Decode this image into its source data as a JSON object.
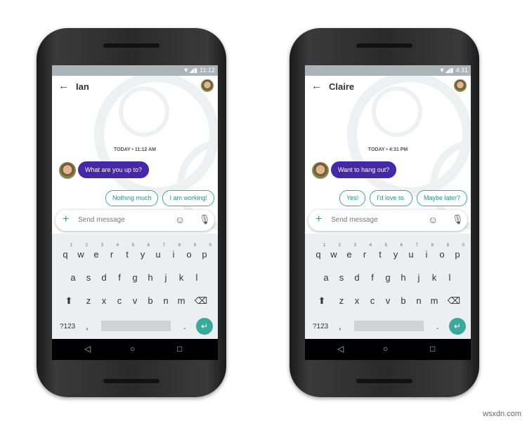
{
  "phones": [
    {
      "time": "11:12",
      "contact": "Ian",
      "timestamp": "TODAY • 11:12 AM",
      "message": "What are you up to?",
      "replies": [
        "Nothing much",
        "I am working!"
      ]
    },
    {
      "time": "4:31",
      "contact": "Claire",
      "timestamp": "TODAY • 4:31 PM",
      "message": "Want to hang out?",
      "replies": [
        "Yes!",
        "I'd love to.",
        "Maybe later?"
      ]
    }
  ],
  "input_placeholder": "Send message",
  "keyboard": {
    "row1": [
      "q",
      "w",
      "e",
      "r",
      "t",
      "y",
      "u",
      "i",
      "o",
      "p"
    ],
    "digits": [
      "1",
      "2",
      "3",
      "4",
      "5",
      "6",
      "7",
      "8",
      "9",
      "0"
    ],
    "row2": [
      "a",
      "s",
      "d",
      "f",
      "g",
      "h",
      "j",
      "k",
      "l"
    ],
    "row3": [
      "z",
      "x",
      "c",
      "v",
      "b",
      "n",
      "m"
    ],
    "symbols": "?123",
    "comma": ",",
    "period": "."
  },
  "icons": {
    "back": "arrow-left-icon",
    "emoji": "emoji-icon",
    "mic": "mic-icon",
    "plus": "plus-icon",
    "enter": "enter-icon"
  },
  "colors": {
    "bubble": "#4528a8",
    "chip": "#3aa8a8",
    "enter": "#3aa99a"
  },
  "watermark": "wsxdn.com"
}
